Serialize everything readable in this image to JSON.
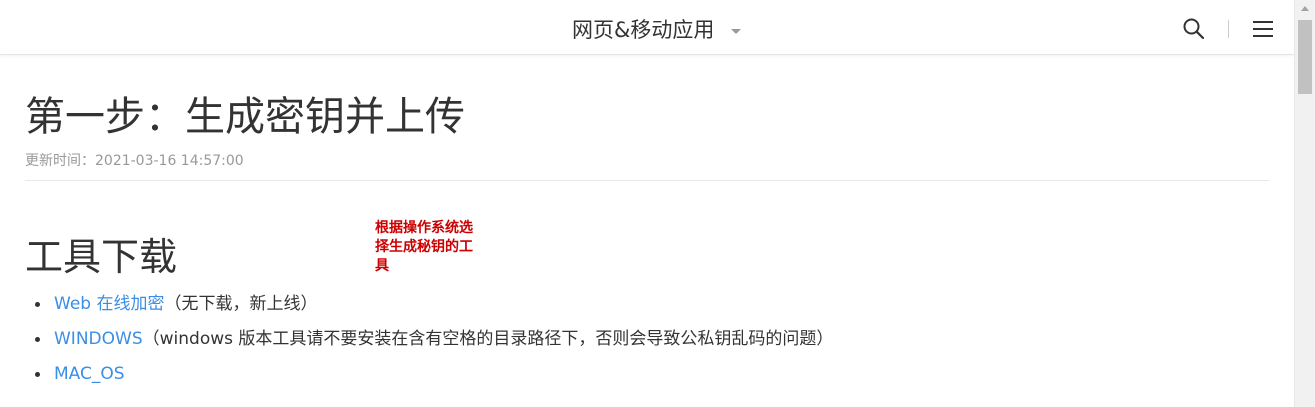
{
  "header": {
    "nav_title": "网页&移动应用",
    "icons": {
      "dropdown": "chevron-down-icon",
      "search": "search-icon",
      "menu": "hamburger-menu-icon"
    }
  },
  "article": {
    "title": "第一步：生成密钥并上传",
    "updated": "更新时间：2021-03-16 14:57:00",
    "section_title": "工具下载",
    "annotation": "根据操作系统选择生成秘钥的工具",
    "items": [
      {
        "link": "Web 在线加密",
        "note": "（无下载，新上线）"
      },
      {
        "link": "WINDOWS",
        "note": "（windows 版本工具请不要安装在含有空格的目录路径下，否则会导致公私钥乱码的问题）"
      },
      {
        "link": "MAC_OS",
        "note": ""
      }
    ]
  },
  "colors": {
    "link": "#3a8ee6",
    "annotation": "#cc0000",
    "muted": "#999999",
    "text": "#333333"
  }
}
